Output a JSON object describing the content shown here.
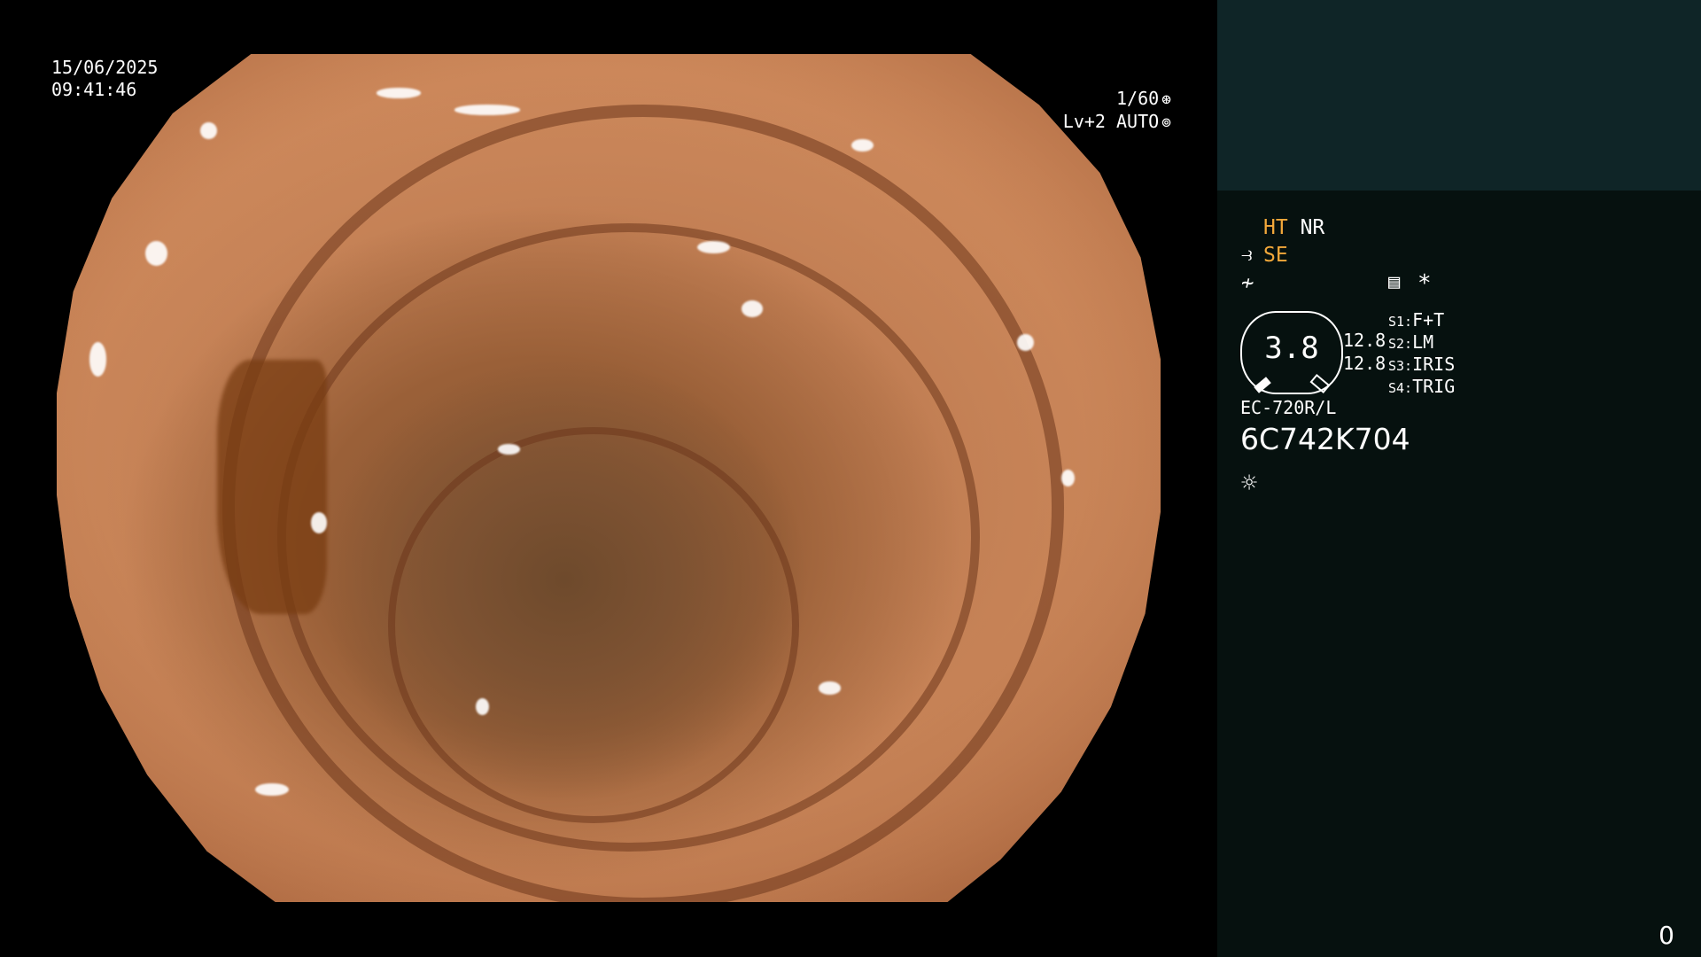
{
  "overlay": {
    "date": "15/06/2025",
    "time": "09:41:46",
    "shutter": "1/60",
    "shutter_icon": "aperture-icon",
    "level": "Lv+2 AUTO",
    "level_icon": "iris-icon"
  },
  "panel": {
    "mode_ht": "HT",
    "mode_nr": "NR",
    "mode_se": "SE",
    "mode2_icon": "scope-tip-icon",
    "enhance_icon": "enhance-icon",
    "menu_icon": "menu-list-icon",
    "asterisk": "*",
    "gauge_value": "3.8",
    "value_1": "12.8",
    "value_2": "12.8",
    "switches": [
      {
        "key": "S1:",
        "value": "F+T"
      },
      {
        "key": "S2:",
        "value": "LM"
      },
      {
        "key": "S3:",
        "value": "IRIS"
      },
      {
        "key": "S4:",
        "value": "TRIG"
      }
    ],
    "scope_model": "EC-720R/L",
    "serial": "6C742K704",
    "light_icon": "light-sun-icon",
    "counter": "0"
  },
  "colors": {
    "mode_accent": "#f2a83a",
    "panel_top": "#0f2527",
    "panel_bg": "#06110f"
  }
}
